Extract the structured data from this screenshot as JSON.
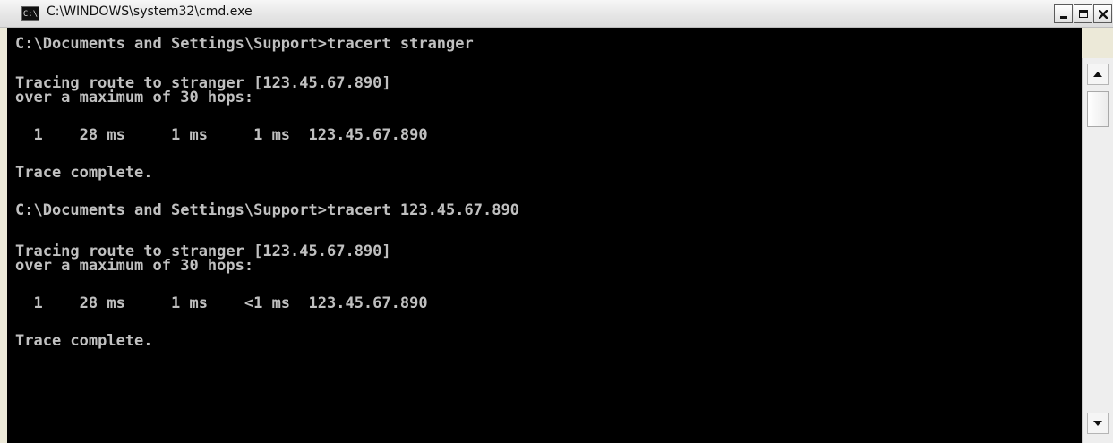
{
  "window": {
    "title": "C:\\WINDOWS\\system32\\cmd.exe",
    "app_icon_label": "C:\\",
    "controls": [
      "minimize",
      "maximize",
      "close"
    ]
  },
  "console": {
    "lines": [
      "C:\\Documents and Settings\\Support>tracert stranger",
      "Tracing route to stranger [123.45.67.890]",
      "over a maximum of 30 hops:",
      "  1    28 ms     1 ms     1 ms  123.45.67.890",
      "Trace complete.",
      "C:\\Documents and Settings\\Support>tracert 123.45.67.890",
      "Tracing route to stranger [123.45.67.890]",
      "over a maximum of 30 hops:",
      "  1    28 ms     1 ms    <1 ms  123.45.67.890",
      "Trace complete."
    ],
    "colors": {
      "background": "#000000",
      "text": "#c0c0c0"
    }
  }
}
